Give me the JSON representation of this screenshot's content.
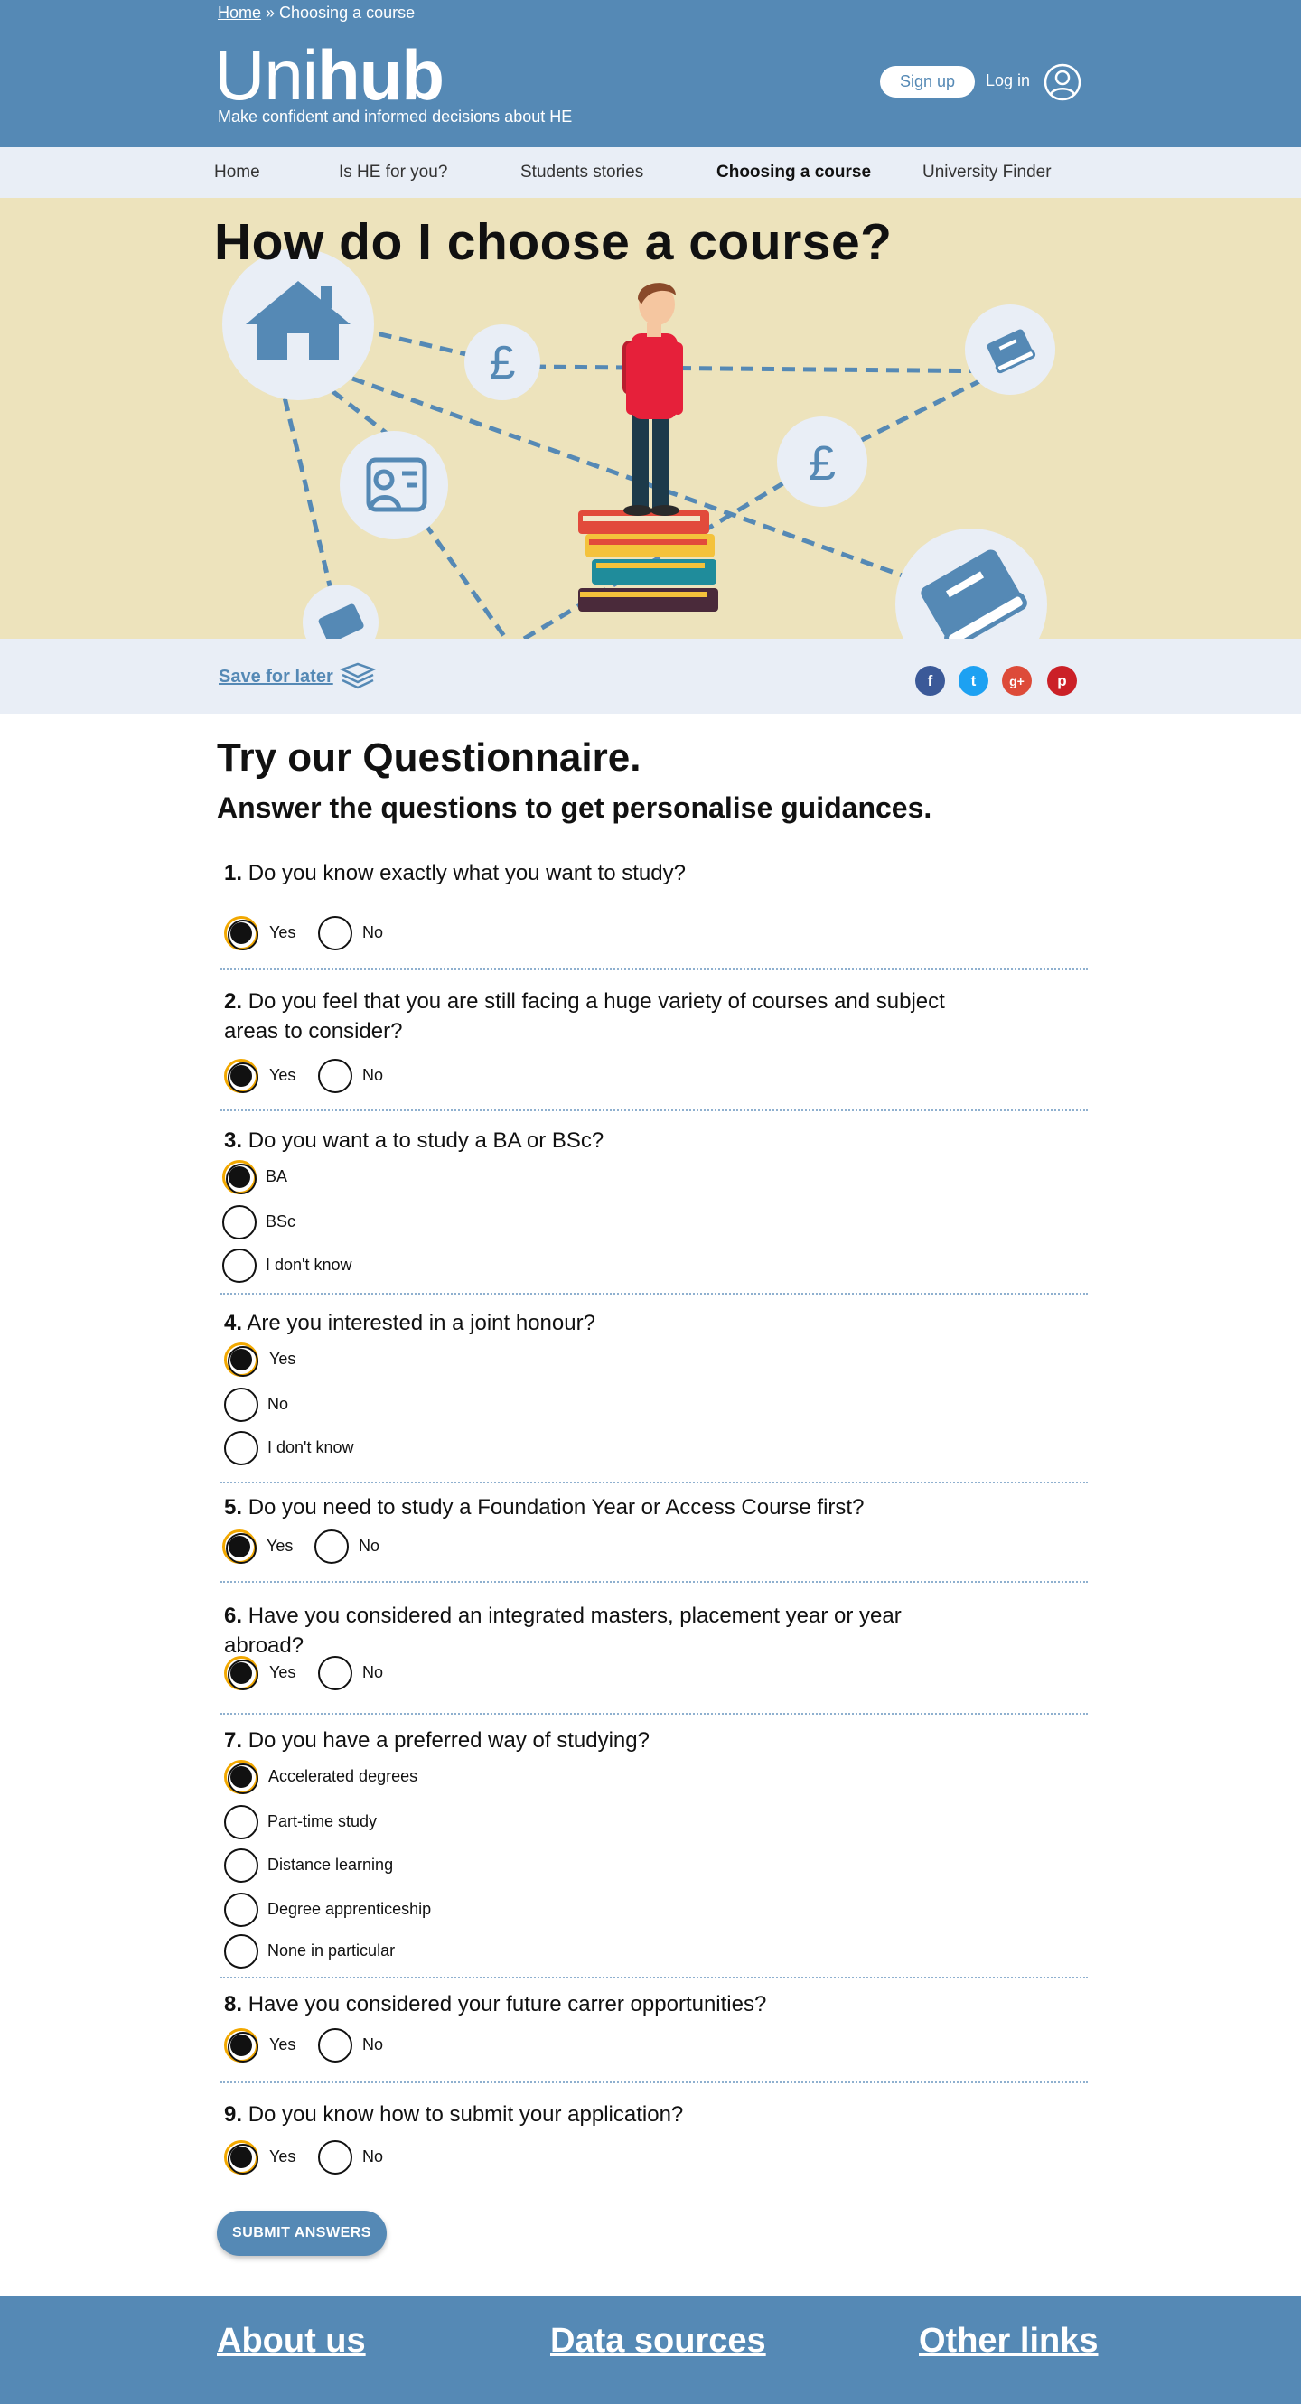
{
  "header": {
    "breadcrumb_home": "Home",
    "breadcrumb_sep": " » ",
    "breadcrumb_current": "Choosing a course",
    "logo_light": "Uni",
    "logo_bold": "hub",
    "tagline": "Make confident and informed decisions about HE",
    "signup_label": "Sign up",
    "login_label": "Log in"
  },
  "nav": {
    "items": [
      {
        "label": "Home"
      },
      {
        "label": "Is HE for you?"
      },
      {
        "label": "Students stories"
      },
      {
        "label": "Choosing a course"
      },
      {
        "label": "University Finder"
      }
    ],
    "active": "Choosing a course"
  },
  "hero": {
    "title": "How do I choose a course?",
    "pound_symbol": "£"
  },
  "share": {
    "save_label": "Save for later",
    "facebook": "f",
    "twitter": "t",
    "googleplus": "g+",
    "pinterest": "p",
    "colors": {
      "facebook": "#3b5998",
      "twitter": "#1da1f2",
      "googleplus": "#dd4b39",
      "pinterest": "#cb2027"
    }
  },
  "questionnaire": {
    "title": "Try our Questionnaire.",
    "subtitle": "Answer the questions to get personalise guidances.",
    "submit_label": "SUBMIT ANSWERS",
    "questions": [
      {
        "num": "1.",
        "text": "Do you know exactly what you want to study?",
        "options": [
          "Yes",
          "No"
        ],
        "selected": "Yes"
      },
      {
        "num": "2.",
        "text": "Do you feel that you are still facing a huge variety of courses and subject areas to consider?",
        "options": [
          "Yes",
          "No"
        ],
        "selected": "Yes"
      },
      {
        "num": "3.",
        "text": "Do you want a to study a BA or BSc?",
        "options": [
          "BA",
          "BSc",
          "I don't know"
        ],
        "selected": "BA"
      },
      {
        "num": "4.",
        "text": "Are you interested in a joint honour?",
        "options": [
          "Yes",
          "No",
          "I don't know"
        ],
        "selected": "Yes"
      },
      {
        "num": "5.",
        "text": "Do you need to study a Foundation Year or Access Course first?",
        "options": [
          "Yes",
          "No"
        ],
        "selected": "Yes"
      },
      {
        "num": "6.",
        "text": "Have you considered an integrated masters, placement year or year abroad?",
        "options": [
          "Yes",
          "No"
        ],
        "selected": "Yes"
      },
      {
        "num": "7.",
        "text": "Do you have a preferred way of studying?",
        "options": [
          "Accelerated degrees",
          "Part-time study",
          "Distance learning",
          "Degree apprenticeship",
          "None in particular"
        ],
        "selected": "Accelerated degrees"
      },
      {
        "num": "8.",
        "text": "Have you considered your future carrer opportunities?",
        "options": [
          "Yes",
          "No"
        ],
        "selected": "Yes"
      },
      {
        "num": "9.",
        "text": "Do you know how to submit your application?",
        "options": [
          "Yes",
          "No"
        ],
        "selected": "Yes"
      }
    ]
  },
  "footer": {
    "links": [
      {
        "label": "About us"
      },
      {
        "label": "Data sources"
      },
      {
        "label": "Other links"
      }
    ]
  },
  "colors": {
    "brand_blue": "#5589b5",
    "nav_bg": "#e9eef6",
    "hero_bg": "#ede3bc",
    "radio_accent": "#f2a800"
  }
}
